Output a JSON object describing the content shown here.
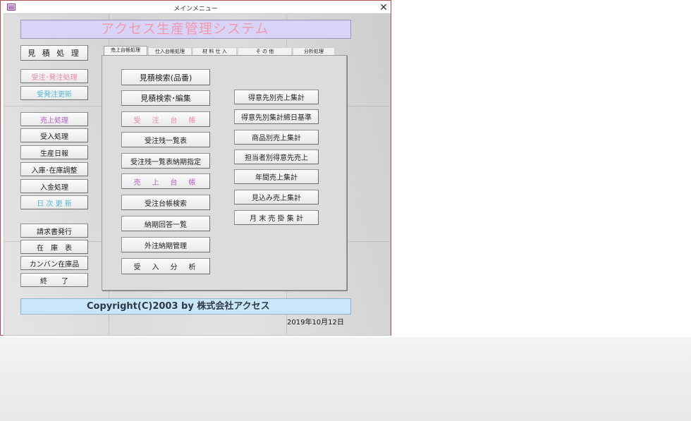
{
  "window": {
    "title": "メインメニュー",
    "close_symbol": "✕"
  },
  "header": {
    "title": "アクセス生産管理システム"
  },
  "left_menu": {
    "estimate": "見 積 処 理",
    "order_issue": "受注･発注処理",
    "order_update": "受発注更新",
    "sales": "売上処理",
    "receiving": "受入処理",
    "production_daily": "生産日報",
    "stock_adjust": "入庫･在庫調整",
    "payment": "入金処理",
    "daily_update": "日 次 更 新",
    "invoice": "請求書発行",
    "inventory": "在　庫　表",
    "kanban": "カンバン在庫品",
    "exit": "終　　了"
  },
  "tabs": [
    "売上台帳処理",
    "仕入台帳処理",
    "材 料 仕 入",
    "そ の 他",
    "分析処理"
  ],
  "panel_left": {
    "estimate_search_part": "見積検索(品番)",
    "estimate_search_edit": "見積検索･編集",
    "order_ledger": "受　注　台　帳",
    "order_backlog": "受注残一覧表",
    "order_backlog_due": "受注残一覧表納期指定",
    "sales_ledger": "売　上　台　帳",
    "order_ledger_search": "受注台帳検索",
    "due_reply_list": "納期回答一覧",
    "outsource_due": "外注納期管理",
    "receipt_analysis": "受　入　分　析"
  },
  "panel_right": {
    "sales_by_customer": "得意先別売上集計",
    "customer_closing": "得意先別集計締日基準",
    "sales_by_product": "商品別売上集計",
    "sales_by_staff": "担当者別得意先売上",
    "annual_sales": "年間売上集計",
    "forecast_sales": "見込み売上集計",
    "month_end": "月 末 売 掛 集 計"
  },
  "footer": {
    "copyright": "Copyright(C)2003 by 株式会社アクセス",
    "date": "2019年10月12日"
  },
  "colors": {
    "banner_bg": "#d7d4f8",
    "banner_text": "#f29aae",
    "footer_bg": "#c9e6fb",
    "pink_text": "#ee88a6",
    "cyan_text": "#55b8d8",
    "violet_text": "#b25fc4",
    "window_border": "#b05050"
  },
  "icons": {
    "app": "form-icon",
    "close": "close-icon"
  }
}
